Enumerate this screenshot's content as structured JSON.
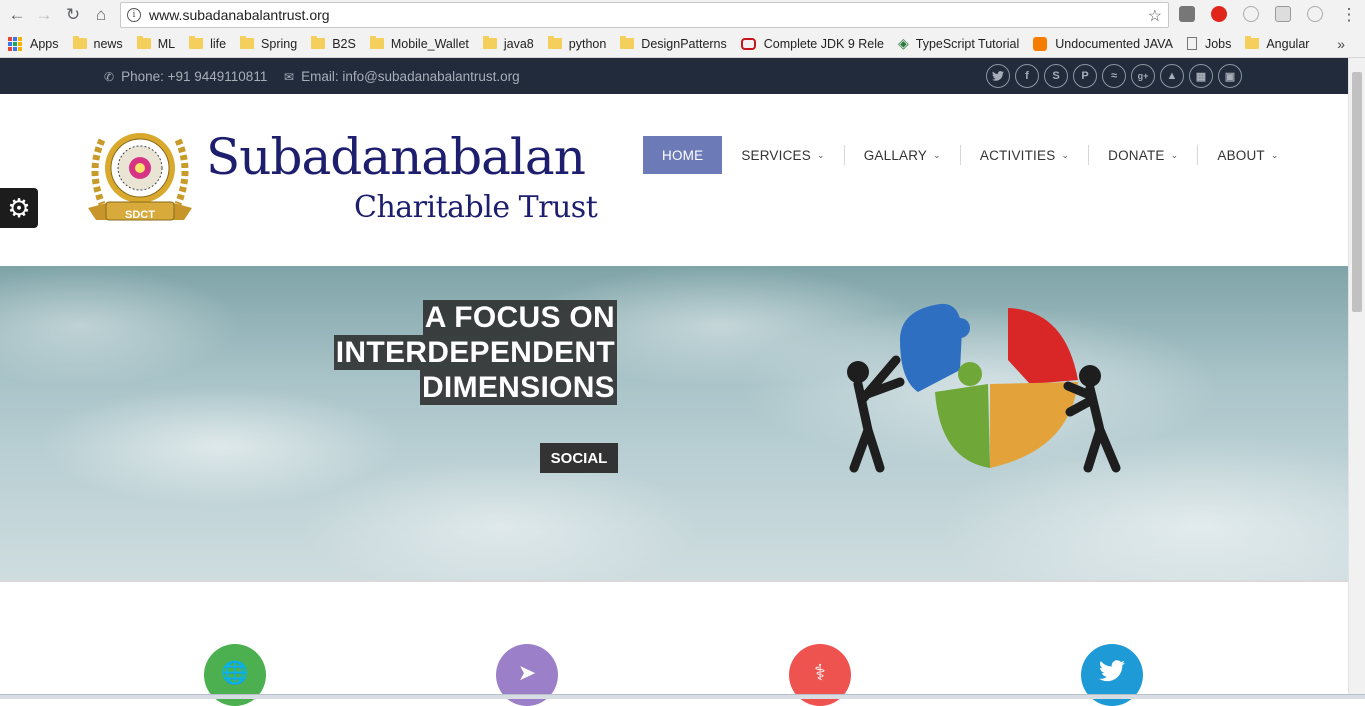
{
  "browser": {
    "url": "www.subadanabalantrust.org",
    "bookmarks": [
      {
        "label": "Apps",
        "icon": "apps-grid-icon"
      },
      {
        "label": "news",
        "icon": "folder-icon"
      },
      {
        "label": "ML",
        "icon": "folder-icon"
      },
      {
        "label": "life",
        "icon": "folder-icon"
      },
      {
        "label": "Spring",
        "icon": "folder-icon"
      },
      {
        "label": "B2S",
        "icon": "folder-icon"
      },
      {
        "label": "Mobile_Wallet",
        "icon": "folder-icon"
      },
      {
        "label": "java8",
        "icon": "folder-icon"
      },
      {
        "label": "python",
        "icon": "folder-icon"
      },
      {
        "label": "DesignPatterns",
        "icon": "folder-icon"
      },
      {
        "label": "Complete JDK 9 Rele",
        "icon": "oracle-icon"
      },
      {
        "label": "TypeScript Tutorial",
        "icon": "diamond-icon"
      },
      {
        "label": "Undocumented JAVA",
        "icon": "blogger-icon"
      },
      {
        "label": "Jobs",
        "icon": "page-icon"
      },
      {
        "label": "Angular",
        "icon": "folder-icon"
      }
    ],
    "more": "»"
  },
  "topbar": {
    "phone": "Phone: +91 9449110811",
    "email": "Email: info@subadanabalantrust.org",
    "social_icons": [
      "twitter-icon",
      "facebook-icon",
      "skype-icon",
      "pinterest-icon",
      "rss-icon",
      "google-plus-icon",
      "android-icon",
      "windows-icon",
      "bus-icon"
    ]
  },
  "logo": {
    "badge": "SDCT",
    "title": "Subadanabalan",
    "subtitle": "Charitable Trust"
  },
  "menu": [
    {
      "label": "HOME",
      "active": true
    },
    {
      "label": "SERVICES",
      "dropdown": true
    },
    {
      "label": "GALLARY",
      "dropdown": true
    },
    {
      "label": "ACTIVITIES",
      "dropdown": true
    },
    {
      "label": "DONATE",
      "dropdown": true
    },
    {
      "label": "ABOUT",
      "dropdown": true
    }
  ],
  "hero": {
    "lines": [
      "A FOCUS ON",
      "INTERDEPENDENT",
      "DIMENSIONS"
    ],
    "button": "SOCIAL"
  },
  "features": [
    {
      "icon": "globe-icon",
      "color": "#4caf50"
    },
    {
      "icon": "rocket-icon",
      "color": "#9b7fc9"
    },
    {
      "icon": "doctor-icon",
      "color": "#ef5350"
    },
    {
      "icon": "twitter-icon",
      "color": "#1e9ad6"
    }
  ],
  "colors": {
    "topbar_bg": "#222b3c",
    "menu_active": "#6d7ab8",
    "logo_text": "#1d1e6e"
  }
}
